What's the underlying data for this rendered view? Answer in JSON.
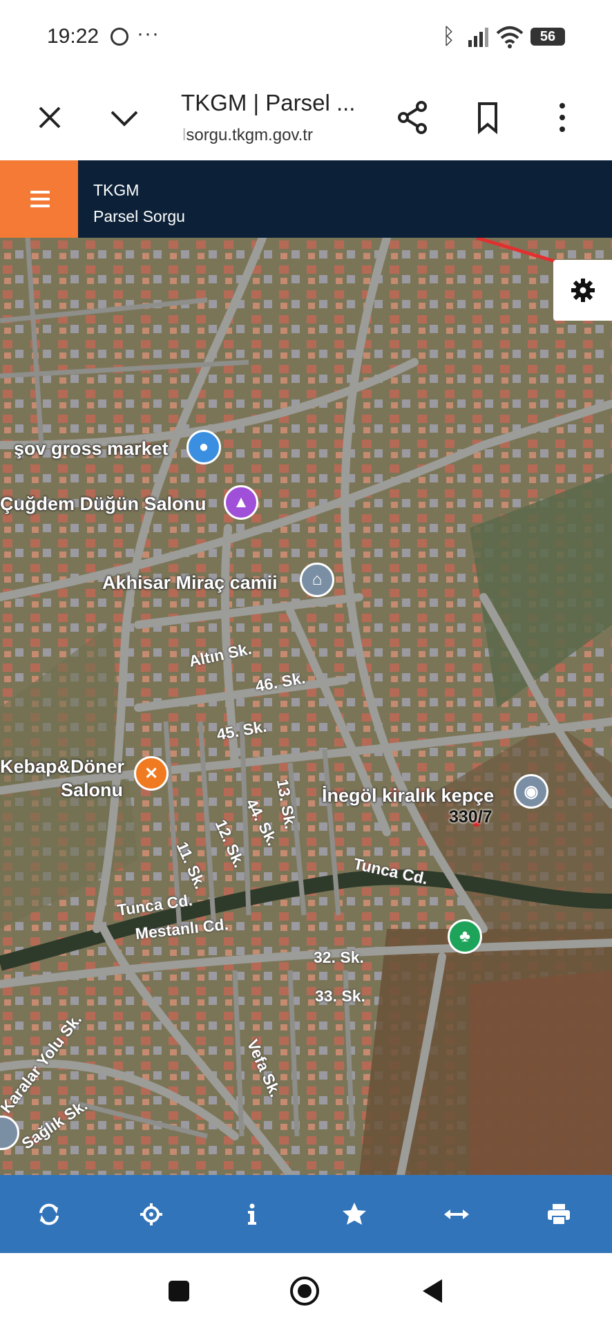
{
  "status": {
    "time": "19:22",
    "battery": "56"
  },
  "browser": {
    "title": "TKGM | Parsel ...",
    "url_prefix": "l",
    "url": "sorgu.tkgm.gov.tr"
  },
  "app": {
    "title": "TKGM",
    "subtitle": "Parsel Sorgu",
    "accent": "#f47a35",
    "header_bg": "#0c2138"
  },
  "map": {
    "places": {
      "market": "şov gross market",
      "wedding": "Çuğdem Düğün Salonu",
      "mosque": "Akhisar Miraç camii",
      "restaurant_1": "Kebap&Döner",
      "restaurant_2": "Salonu",
      "kepce": "İnegöl kiralık kepçe"
    },
    "parcel_label": "330/7",
    "roads": {
      "altin": "Altın Sk.",
      "s46": "46. Sk.",
      "s45": "45. Sk.",
      "s13": "13. Sk.",
      "s44": "44. Sk.",
      "s12": "12. Sk.",
      "s11": "11. Sk.",
      "tunca1": "Tunca Cd.",
      "tunca2": "Tunca Cd.",
      "mestanli": "Mestanlı Cd.",
      "s32": "32. Sk.",
      "s33": "33. Sk.",
      "vefa": "Vefa Sk.",
      "karalar": "Karalar Yolu Sk.",
      "saglik": "Sağlık Sk."
    }
  },
  "toolbar": {
    "bg": "#3274ba",
    "items": [
      "refresh-icon",
      "locate-icon",
      "info-icon",
      "star-icon",
      "measure-icon",
      "print-icon"
    ]
  }
}
